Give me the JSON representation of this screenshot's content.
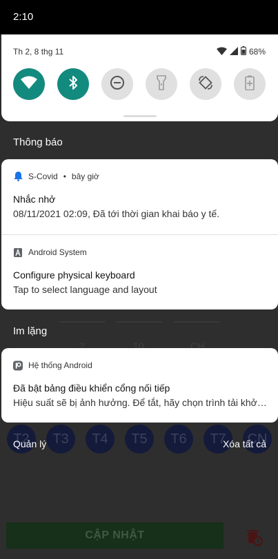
{
  "status_bar": {
    "time": "2:10"
  },
  "quick_settings": {
    "date": "Th 2, 8 thg 11",
    "battery": "68%",
    "tiles": [
      {
        "name": "wifi",
        "state": "on"
      },
      {
        "name": "bluetooth",
        "state": "on"
      },
      {
        "name": "do-not-disturb",
        "state": "off"
      },
      {
        "name": "flashlight",
        "state": "off"
      },
      {
        "name": "auto-rotate",
        "state": "off"
      },
      {
        "name": "battery-saver",
        "state": "off"
      }
    ]
  },
  "sections": {
    "notifications": "Thông báo",
    "silent": "Im lặng"
  },
  "notifications": [
    {
      "app": "S-Covid",
      "time": "bây giờ",
      "title": "Nhắc nhở",
      "text": "08/11/2021 02:09, Đã tới thời gian khai báo y tế."
    },
    {
      "app": "Android System",
      "title": "Configure physical keyboard",
      "text": "Tap to select language and layout"
    },
    {
      "app": "Hệ thống Android",
      "title": "Đã bật bảng điều khiển cổng nối tiếp",
      "text": "Hiệu suất sẽ bị ảnh hưởng. Để tắt, hãy chọn trình tải khởi động."
    }
  ],
  "footer": {
    "manage": "Quản lý",
    "clear_all": "Xóa tất cả"
  },
  "background_app": {
    "numbers": [
      "2",
      "10",
      "CH"
    ],
    "days": [
      "T2",
      "T3",
      "T4",
      "T5",
      "T6",
      "T7",
      "CN"
    ],
    "update_button": "CẬP NHẬT"
  },
  "colors": {
    "accent": "#138a7e",
    "shade_bg": "#2b2b2b"
  }
}
